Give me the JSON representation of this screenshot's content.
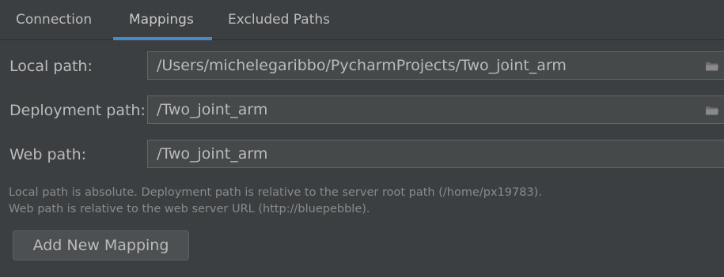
{
  "tabs": [
    {
      "label": "Connection",
      "active": false
    },
    {
      "label": "Mappings",
      "active": true
    },
    {
      "label": "Excluded Paths",
      "active": false
    }
  ],
  "mappings": {
    "local_path": {
      "label": "Local path:",
      "value": "/Users/michelegaribbo/PycharmProjects/Two_joint_arm",
      "browse_icon": "folder-icon"
    },
    "deployment_path": {
      "label": "Deployment path:",
      "value": "/Two_joint_arm",
      "browse_icon": "folder-icon"
    },
    "web_path": {
      "label": "Web path:",
      "value": "/Two_joint_arm"
    }
  },
  "help": {
    "line1": "Local path is absolute. Deployment path is relative to the server root path (/home/px19783).",
    "line2": "Web path is relative to the web server URL (http://bluepebble)."
  },
  "buttons": {
    "add_mapping": "Add New Mapping"
  },
  "colors": {
    "background": "#3c3f41",
    "accent": "#4a88c7",
    "field_bg": "#45494a",
    "field_border": "#646464",
    "text": "#bbbbbb",
    "help_text": "#8a8a8a"
  }
}
